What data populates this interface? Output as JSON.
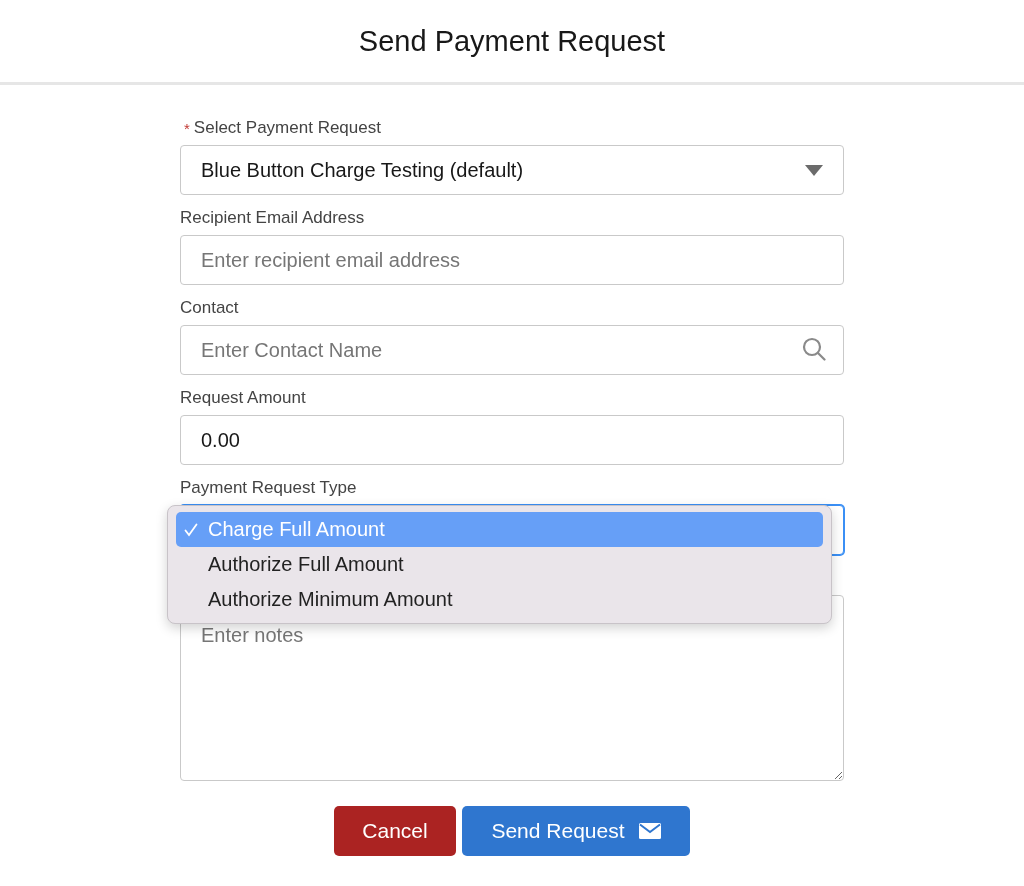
{
  "title": "Send Payment Request",
  "fields": [
    {
      "kind": "select",
      "label": "Select Payment Request",
      "required_mark": "*",
      "value": "Blue Button Charge Testing (default)"
    },
    {
      "kind": "text",
      "label": "Recipient Email Address",
      "placeholder": "Enter recipient email address"
    },
    {
      "kind": "search",
      "label": "Contact",
      "placeholder": "Enter Contact Name"
    },
    {
      "kind": "text",
      "label": "Request Amount",
      "value": "0.00"
    },
    {
      "kind": "menu",
      "label": "Payment Request Type",
      "focused": true,
      "options": [
        {
          "label": "Charge Full Amount",
          "selected": true
        },
        {
          "label": "Authorize Full Amount",
          "selected": false
        },
        {
          "label": "Authorize Minimum Amount",
          "selected": false
        }
      ]
    },
    {
      "kind": "textarea",
      "placeholder": "Enter notes"
    }
  ],
  "buttons": [
    {
      "label": "Cancel",
      "kind": "danger"
    },
    {
      "label": "Send Request",
      "kind": "primary"
    }
  ]
}
